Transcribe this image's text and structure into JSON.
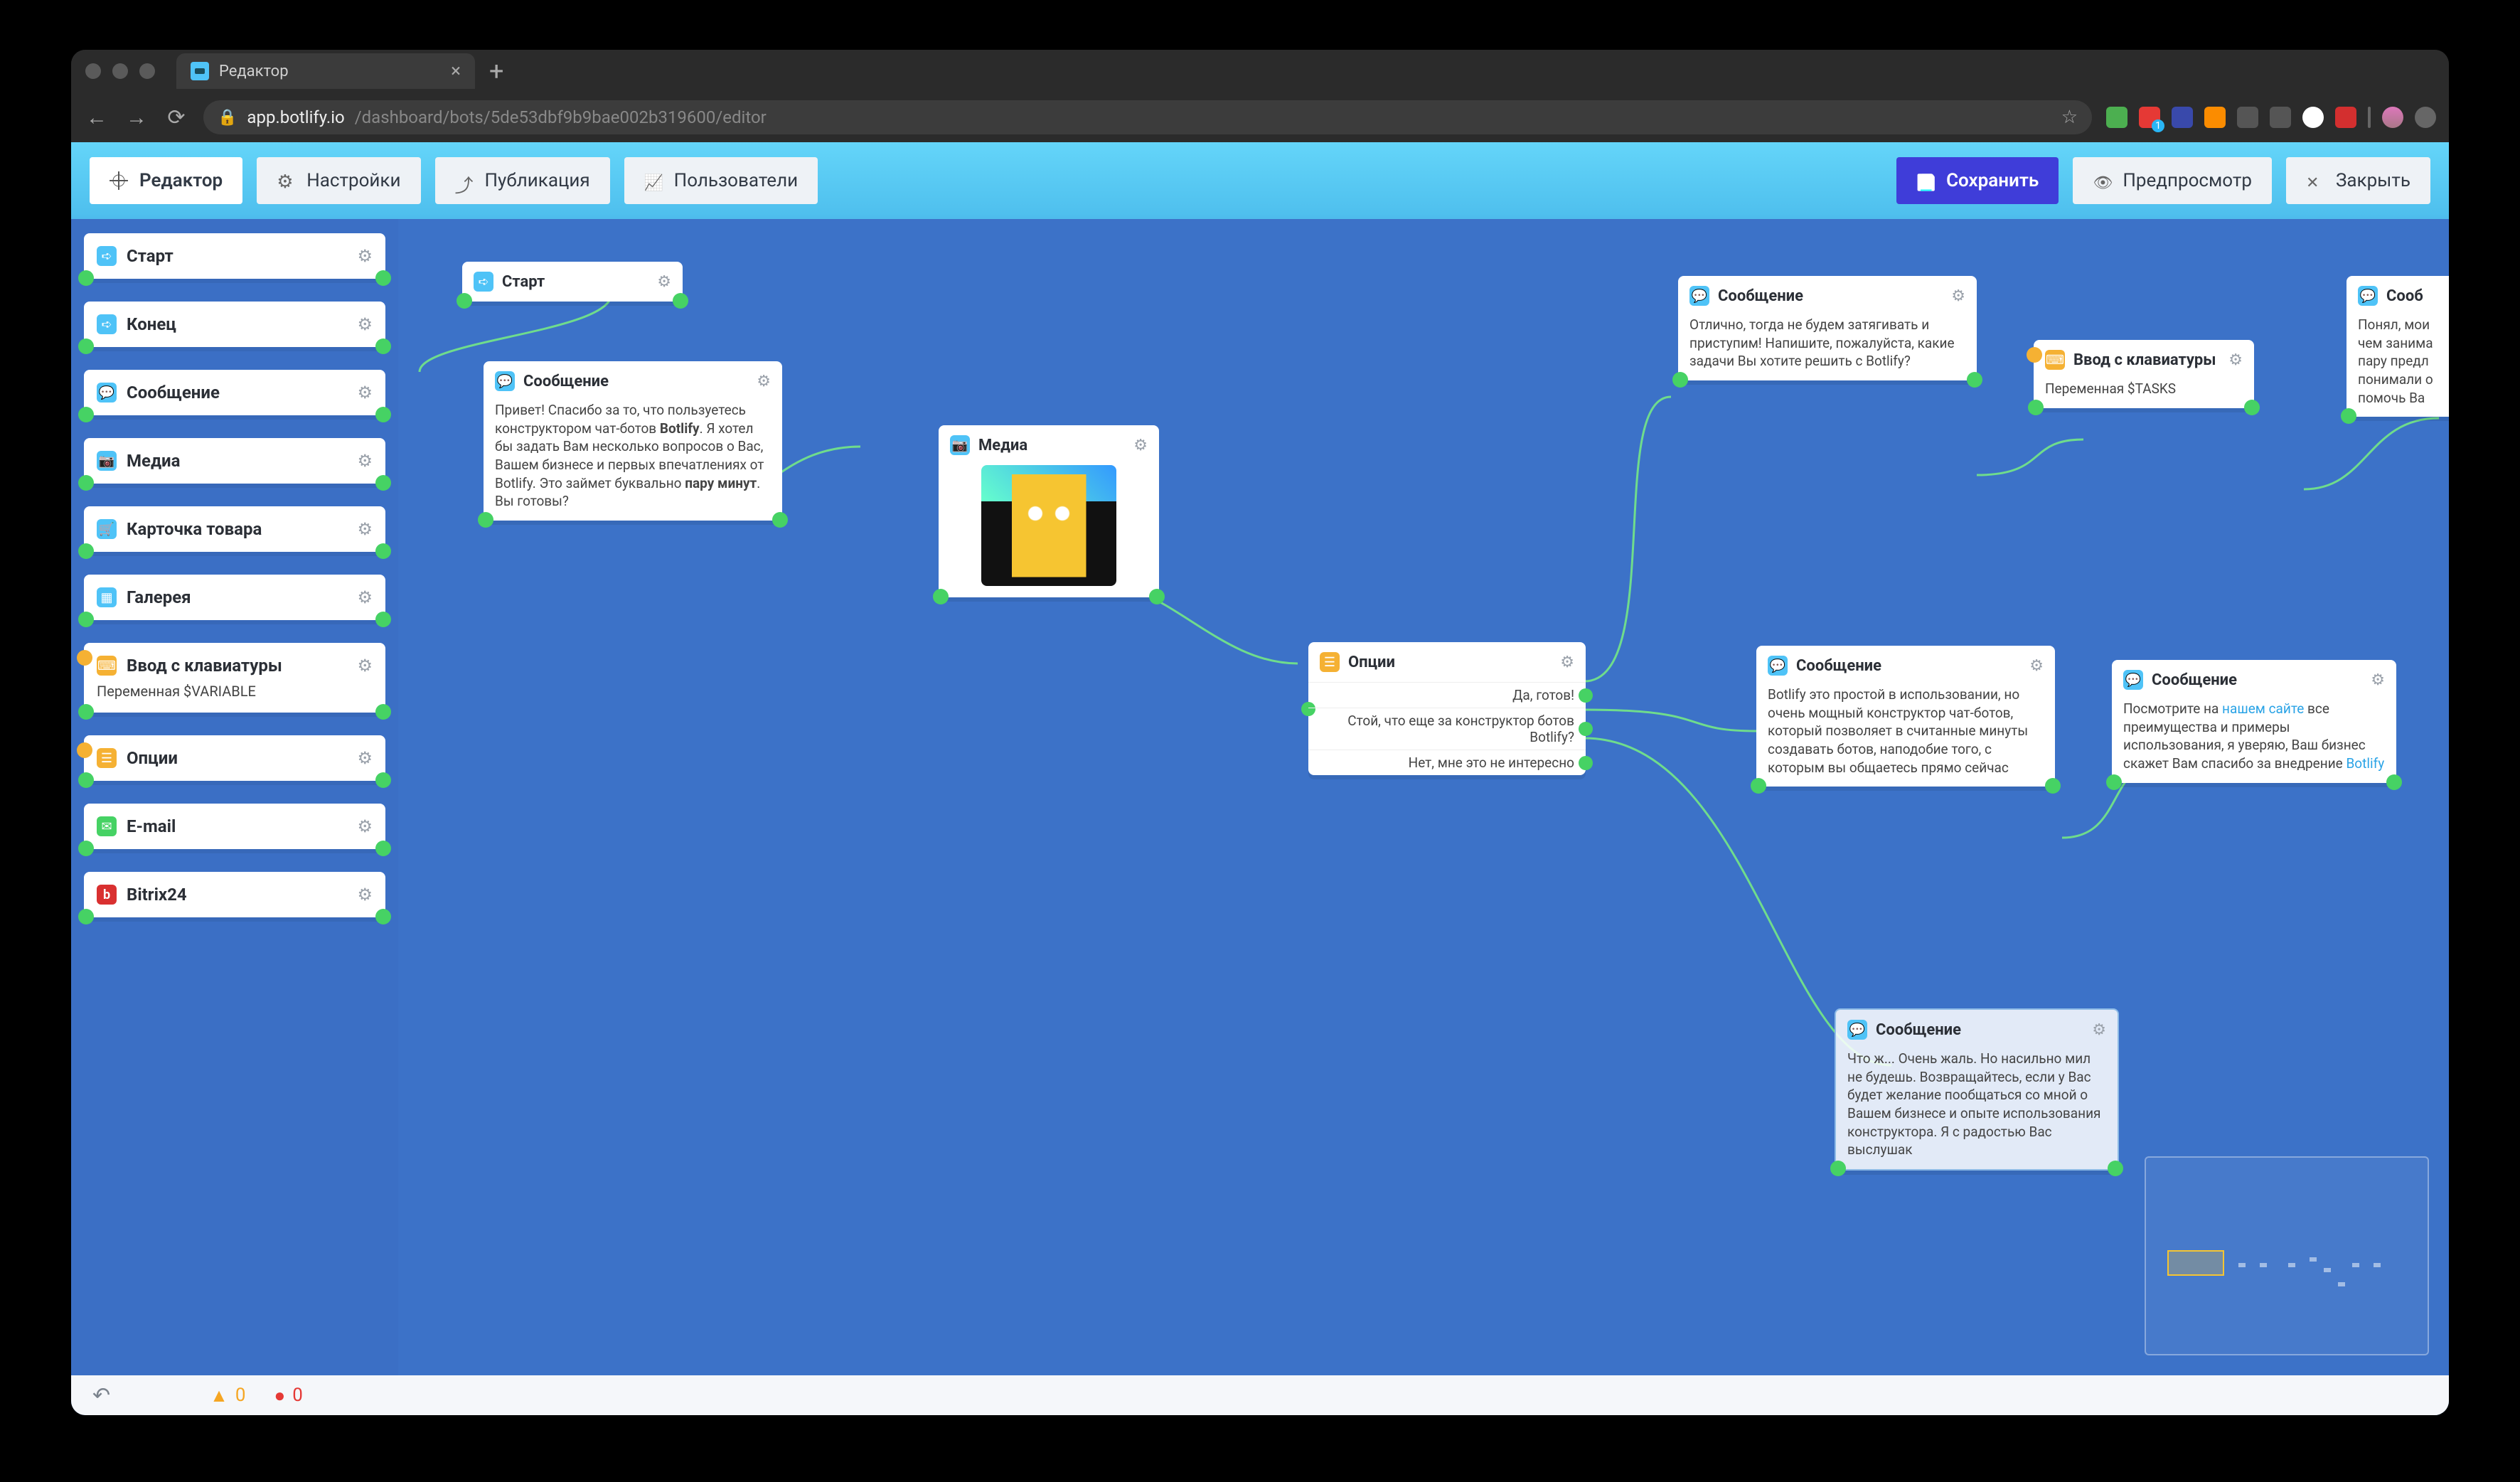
{
  "browser": {
    "tab_title": "Редактор",
    "url_host": "app.botlify.io",
    "url_path": "/dashboard/bots/5de53dbf9b9bae002b319600/editor"
  },
  "toolbar": {
    "editor": "Редактор",
    "settings": "Настройки",
    "publish": "Публикация",
    "users": "Пользователи",
    "save": "Сохранить",
    "preview": "Предпросмотр",
    "close": "Закрыть"
  },
  "sidebar": [
    {
      "icon": "flow",
      "title": "Старт"
    },
    {
      "icon": "flow",
      "title": "Конец"
    },
    {
      "icon": "msg",
      "title": "Сообщение"
    },
    {
      "icon": "cam",
      "title": "Медиа"
    },
    {
      "icon": "card",
      "title": "Карточка товара"
    },
    {
      "icon": "gal",
      "title": "Галерея"
    },
    {
      "icon": "kb",
      "title": "Ввод с клавиатуры",
      "sub": "Переменная $VARIABLE",
      "yellow_in": true
    },
    {
      "icon": "opt",
      "title": "Опции",
      "yellow_in": true
    },
    {
      "icon": "mail",
      "title": "E-mail"
    },
    {
      "icon": "bx",
      "title": "Bitrix24"
    }
  ],
  "bottombar": {
    "warn": "0",
    "err": "0"
  },
  "canvas": {
    "start": {
      "title": "Старт"
    },
    "msg1": {
      "title": "Сообщение",
      "body_pre": "Привет! Спасибо за то, что пользуетесь конструктором чат-ботов ",
      "bold1": "Botlify",
      "body_mid": ". Я хотел бы задать Вам несколько вопросов о Вас, Вашем бизнесе и первых впечатлениях от Botlify. Это займет буквально ",
      "bold2": "пару минут",
      "body_post": ". Вы готовы?"
    },
    "media": {
      "title": "Медиа"
    },
    "options": {
      "title": "Опции",
      "opt1": "Да, готов!",
      "opt2": "Стой, что еще за конструктор ботов Botlify?",
      "opt3": "Нет, мне это не интересно"
    },
    "msg2": {
      "title": "Сообщение",
      "body": "Отлично, тогда не будем затягивать и приступим! Напишите, пожалуйста, какие задачи Вы хотите решить с Botlify?"
    },
    "kb": {
      "title": "Ввод с клавиатуры",
      "sub": "Переменная $TASKS"
    },
    "msg_right_cut": {
      "title": "Сооб",
      "body": "Понял, мои\nчем занима\nпару предл\nпонимали о\nпомочь Ва"
    },
    "msg3": {
      "title": "Сообщение",
      "body": "Botlify это простой в использовании, но очень мощный конструктор чат-ботов, который позволяет в считанные минуты создавать ботов, наподобие того, с которым вы общаетесь прямо сейчас"
    },
    "msg4": {
      "title": "Сообщение",
      "pre": "Посмотрите на ",
      "link": "нашем сайте",
      "mid": " все преимущества и примеры использования, я уверяю, Ваш бизнес скажет Вам спасибо за внедрение ",
      "link2": "Botlify"
    },
    "msg5": {
      "title": "Сообщение",
      "body": "Что ж... Очень жаль. Но насильно мил не будешь. Возвращайтесь, если у Вас будет желание пообщаться со мной о Вашем бизнесе и опыте использования конструктора. Я с радостью Вас выслушак"
    }
  }
}
